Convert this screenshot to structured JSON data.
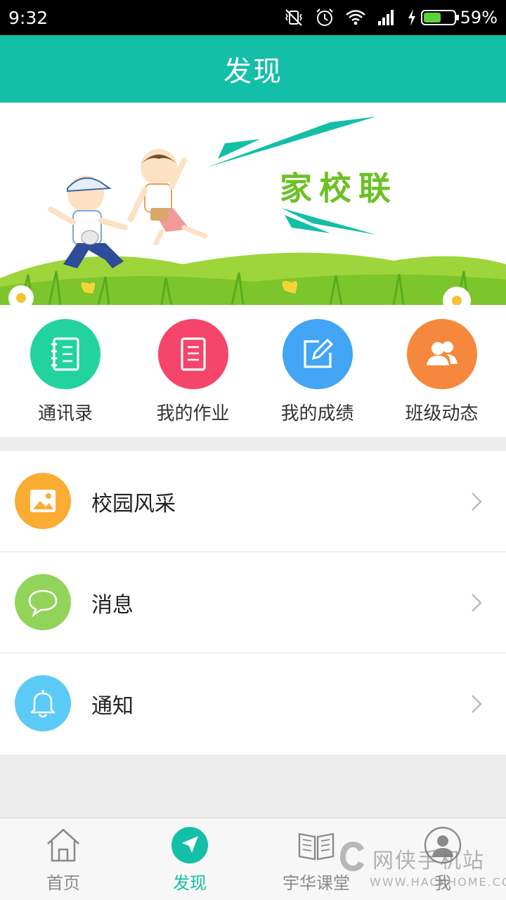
{
  "status_bar": {
    "time": "9:32",
    "battery_percent": "59%",
    "battery_level": 0.59,
    "icons": [
      "vibrate-off-icon",
      "alarm-icon",
      "wifi-icon",
      "signal-icon",
      "charging-icon",
      "battery-icon"
    ]
  },
  "header": {
    "title": "发现"
  },
  "banner": {
    "text": "家校联"
  },
  "shortcuts": [
    {
      "label": "通讯录",
      "icon": "notebook-icon",
      "color": "#22d39e"
    },
    {
      "label": "我的作业",
      "icon": "document-icon",
      "color": "#f5456a"
    },
    {
      "label": "我的成绩",
      "icon": "edit-icon",
      "color": "#42a5f5"
    },
    {
      "label": "班级动态",
      "icon": "people-icon",
      "color": "#f5883d"
    }
  ],
  "menu": [
    {
      "label": "校园风采",
      "icon": "image-icon",
      "color": "#fbac33"
    },
    {
      "label": "消息",
      "icon": "chat-bubble-icon",
      "color": "#92d35a"
    },
    {
      "label": "通知",
      "icon": "bell-icon",
      "color": "#5ccaf7"
    }
  ],
  "tabs": [
    {
      "label": "首页",
      "icon": "home-icon"
    },
    {
      "label": "发现",
      "icon": "compass-arrow-icon",
      "active": true
    },
    {
      "label": "宇华课堂",
      "icon": "book-icon"
    },
    {
      "label": "我",
      "icon": "user-icon"
    }
  ],
  "watermark": {
    "title": "网侠手机站",
    "url": "WWW.HACKHOME.COM"
  },
  "colors": {
    "accent": "#13bfa6",
    "background": "#ececec"
  }
}
